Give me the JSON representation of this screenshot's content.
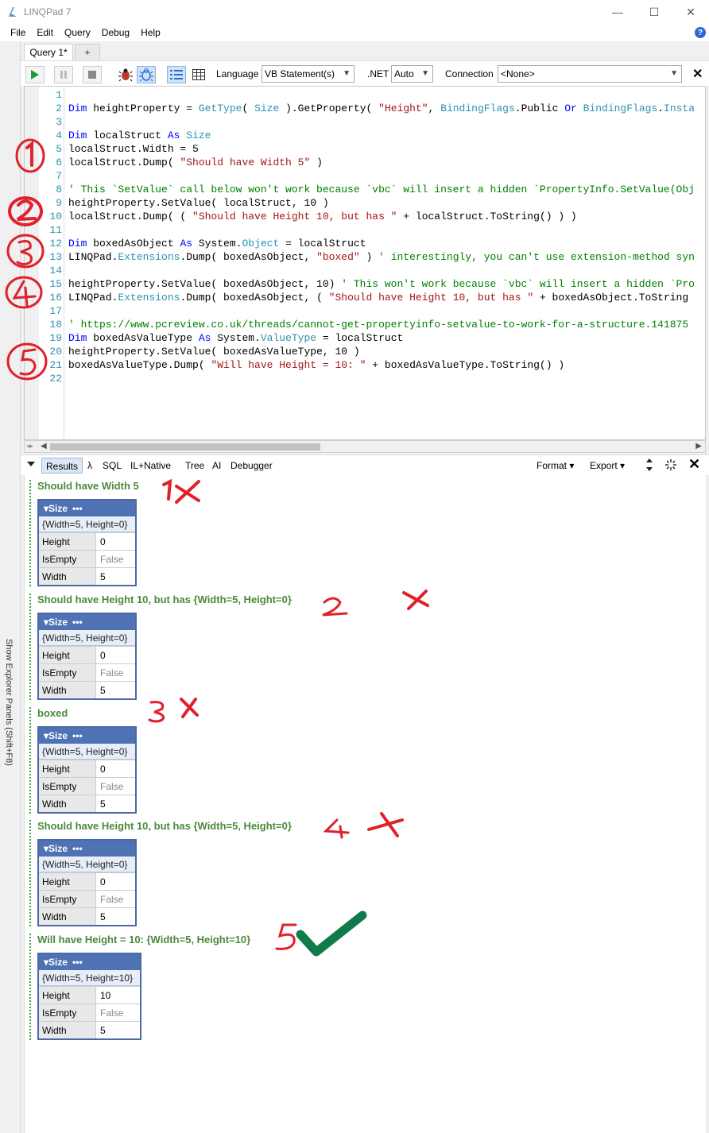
{
  "window": {
    "title": "LINQPad 7",
    "minimize": "—",
    "maximize": "☐",
    "close": "✕"
  },
  "menu": [
    "File",
    "Edit",
    "Query",
    "Debug",
    "Help"
  ],
  "tabs": {
    "active": "Query 1*",
    "add": "+"
  },
  "toolbar": {
    "language_label": "Language",
    "language_value": "VB Statement(s)",
    "dotnet_label": ".NET",
    "dotnet_value": "Auto",
    "connection_label": "Connection",
    "connection_value": "<None>",
    "close": "✕"
  },
  "side_panel": {
    "label": "Show Explorer Panels  (Shift+F8)"
  },
  "results_bar": {
    "tabs": [
      "Results",
      "λ",
      "SQL",
      "IL+Native",
      "Tree",
      "AI",
      "Debugger"
    ],
    "format": "Format ▾",
    "export": "Export ▾"
  },
  "dumps": [
    {
      "header": "Should have Width 5",
      "type": "Size",
      "summary": "{Width=5, Height=0}",
      "rows": [
        [
          "Height",
          "0"
        ],
        [
          "IsEmpty",
          "False"
        ],
        [
          "Width",
          "5"
        ]
      ]
    },
    {
      "header": "Should have Height 10, but has {Width=5, Height=0}",
      "type": "Size",
      "summary": "{Width=5, Height=0}",
      "rows": [
        [
          "Height",
          "0"
        ],
        [
          "IsEmpty",
          "False"
        ],
        [
          "Width",
          "5"
        ]
      ]
    },
    {
      "header": "boxed",
      "type": "Size",
      "summary": "{Width=5, Height=0}",
      "rows": [
        [
          "Height",
          "0"
        ],
        [
          "IsEmpty",
          "False"
        ],
        [
          "Width",
          "5"
        ]
      ]
    },
    {
      "header": "Should have Height 10, but has {Width=5, Height=0}",
      "type": "Size",
      "summary": "{Width=5, Height=0}",
      "rows": [
        [
          "Height",
          "0"
        ],
        [
          "IsEmpty",
          "False"
        ],
        [
          "Width",
          "5"
        ]
      ]
    },
    {
      "header": "Will have Height = 10: {Width=5, Height=10}",
      "type": "Size",
      "summary": "{Width=5, Height=10}",
      "rows": [
        [
          "Height",
          "10"
        ],
        [
          "IsEmpty",
          "False"
        ],
        [
          "Width",
          "5"
        ]
      ]
    }
  ],
  "dump_menu_glyph": "•••",
  "code_line_numbers": [
    "1",
    "2",
    "3",
    "4",
    "5",
    "6",
    "7",
    "8",
    "9",
    "10",
    "11",
    "12",
    "13",
    "14",
    "15",
    "16",
    "17",
    "18",
    "19",
    "20",
    "21",
    "22"
  ],
  "code_lines": [
    "",
    "Dim heightProperty = GetType( Size ).GetProperty( \"Height\", BindingFlags.Public Or BindingFlags.Insta",
    "",
    "Dim localStruct As Size",
    "localStruct.Width = 5",
    "localStruct.Dump( \"Should have Width 5\" )",
    "",
    "' This `SetValue` call below won't work because `vbc` will insert a hidden `PropertyInfo.SetValue(Obj",
    "heightProperty.SetValue( localStruct, 10 )",
    "localStruct.Dump( ( \"Should have Height 10, but has \" + localStruct.ToString() ) )",
    "",
    "Dim boxedAsObject As System.Object = localStruct",
    "LINQPad.Extensions.Dump( boxedAsObject, \"boxed\" ) ' interestingly, you can't use extension-method syn",
    "",
    "heightProperty.SetValue( boxedAsObject, 10) ' This won't work because `vbc` will insert a hidden `Pro",
    "LINQPad.Extensions.Dump( boxedAsObject, ( \"Should have Height 10, but has \" + boxedAsObject.ToString",
    "",
    "' https://www.pcreview.co.uk/threads/cannot-get-propertyinfo-setvalue-to-work-for-a-structure.141875",
    "Dim boxedAsValueType As System.ValueType = localStruct",
    "heightProperty.SetValue( boxedAsValueType, 10 )",
    "boxedAsValueType.Dump( \"Will have Height = 10: \" + boxedAsValueType.ToString() )",
    ""
  ],
  "annotations": {
    "left_numbers": [
      "1",
      "2",
      "3",
      "4",
      "5"
    ],
    "result_marks": [
      "1",
      "2",
      "3",
      "4",
      "5"
    ],
    "colors": {
      "red": "#e0202a",
      "green": "#0f7a4a"
    }
  }
}
